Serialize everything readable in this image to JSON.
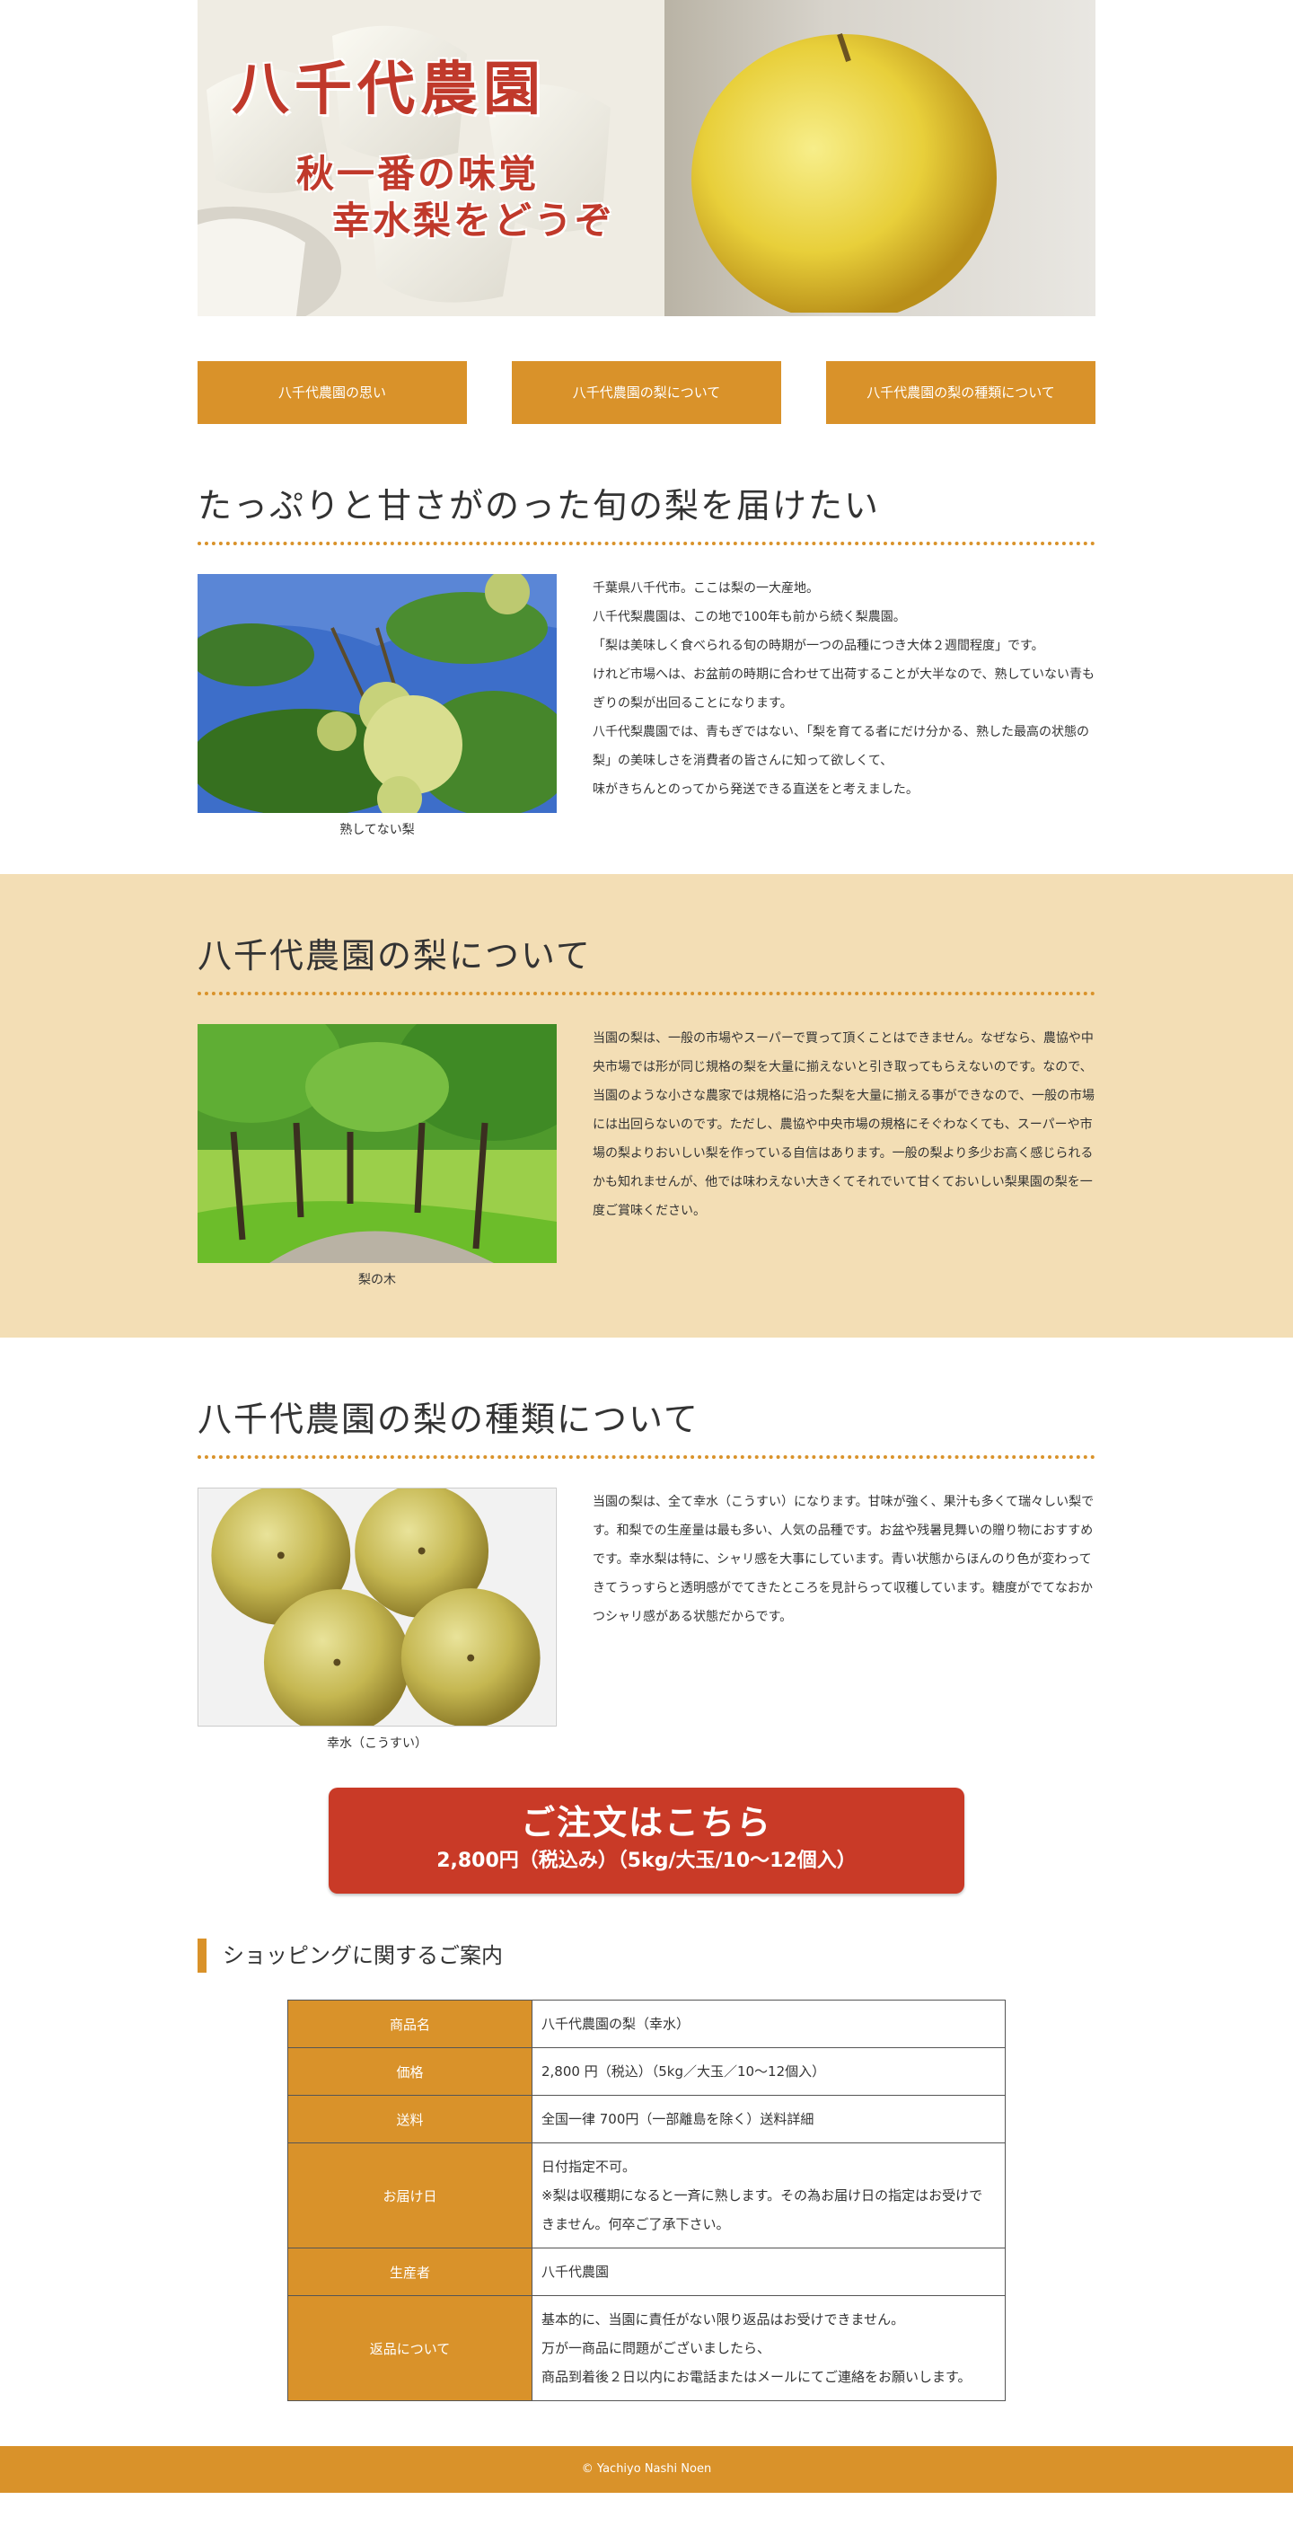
{
  "hero": {
    "title": "八千代農園",
    "catch_line1": "秋一番の味覚",
    "catch_line2": "幸水梨をどうぞ"
  },
  "nav": [
    {
      "label": "八千代農園の思い"
    },
    {
      "label": "八千代農園の梨について"
    },
    {
      "label": "八千代農園の梨の種類について"
    }
  ],
  "section1": {
    "heading": "たっぷりと甘さがのった旬の梨を届けたい",
    "caption": "熟してない梨",
    "paragraphs": [
      "千葉県八千代市。ここは梨の一大産地。",
      "八千代梨農園は、この地で100年も前から続く梨農園。",
      "「梨は美味しく食べられる旬の時期が一つの品種につき大体２週間程度」です。",
      "けれど市場へは、お盆前の時期に合わせて出荷することが大半なので、熟していない青もぎりの梨が出回ることになります。",
      "八千代梨農園では、青もぎではない、「梨を育てる者にだけ分かる、熟した最高の状態の梨」の美味しさを消費者の皆さんに知って欲しくて、",
      "味がきちんとのってから発送できる直送をと考えました。"
    ]
  },
  "section2": {
    "heading": "八千代農園の梨について",
    "caption": "梨の木",
    "text": "当園の梨は、一般の市場やスーパーで買って頂くことはできません。なぜなら、農協や中央市場では形が同じ規格の梨を大量に揃えないと引き取ってもらえないのです。なので、当園のような小さな農家では規格に沿った梨を大量に揃える事ができなので、一般の市場には出回らないのです。ただし、農協や中央市場の規格にそぐわなくても、スーパーや市場の梨よりおいしい梨を作っている自信はあります。一般の梨より多少お高く感じられるかも知れませんが、他では味わえない大きくてそれでいて甘くておいしい梨果園の梨を一度ご賞味ください。"
  },
  "section3": {
    "heading": "八千代農園の梨の種類について",
    "caption": "幸水（こうすい）",
    "text": "当園の梨は、全て幸水（こうすい）になります。甘味が強く、果汁も多くて瑞々しい梨です。和梨での生産量は最も多い、人気の品種です。お盆や残暑見舞いの贈り物におすすめです。幸水梨は特に、シャリ感を大事にしています。青い状態からほんのり色が変わってきてうっすらと透明感がでてきたところを見計らって収穫しています。糖度がでてなおかつシャリ感がある状態だからです。"
  },
  "order": {
    "label": "ご注文はこちら",
    "price": "2,800円（税込み）（5kg/大玉/10〜12個入）"
  },
  "guide": {
    "title": "ショッピングに関するご案内",
    "rows": [
      {
        "label": "商品名",
        "lines": [
          "八千代農園の梨（幸水）"
        ]
      },
      {
        "label": "価格",
        "lines": [
          "2,800 円（税込）（5kg／大玉／10〜12個入）"
        ]
      },
      {
        "label": "送料",
        "lines": [
          "全国一律 700円（一部離島を除く）送料詳細"
        ]
      },
      {
        "label": "お届け日",
        "lines": [
          "日付指定不可。",
          "※梨は収穫期になると一斉に熟します。その為お届け日の指定はお受けできません。何卒ご了承下さい。"
        ]
      },
      {
        "label": "生産者",
        "lines": [
          "八千代農園"
        ]
      },
      {
        "label": "返品について",
        "lines": [
          "基本的に、当園に責任がない限り返品はお受けできません。",
          "万が一商品に問題がございましたら、",
          "商品到着後２日以内にお電話またはメールにてご連絡をお願いします。"
        ]
      }
    ]
  },
  "footer": {
    "copyright": "© Yachiyo Nashi Noen"
  },
  "colors": {
    "accent": "#d9922a",
    "beige": "#f3deb5",
    "order_red": "#c93a27",
    "hero_text": "#c0392b"
  }
}
